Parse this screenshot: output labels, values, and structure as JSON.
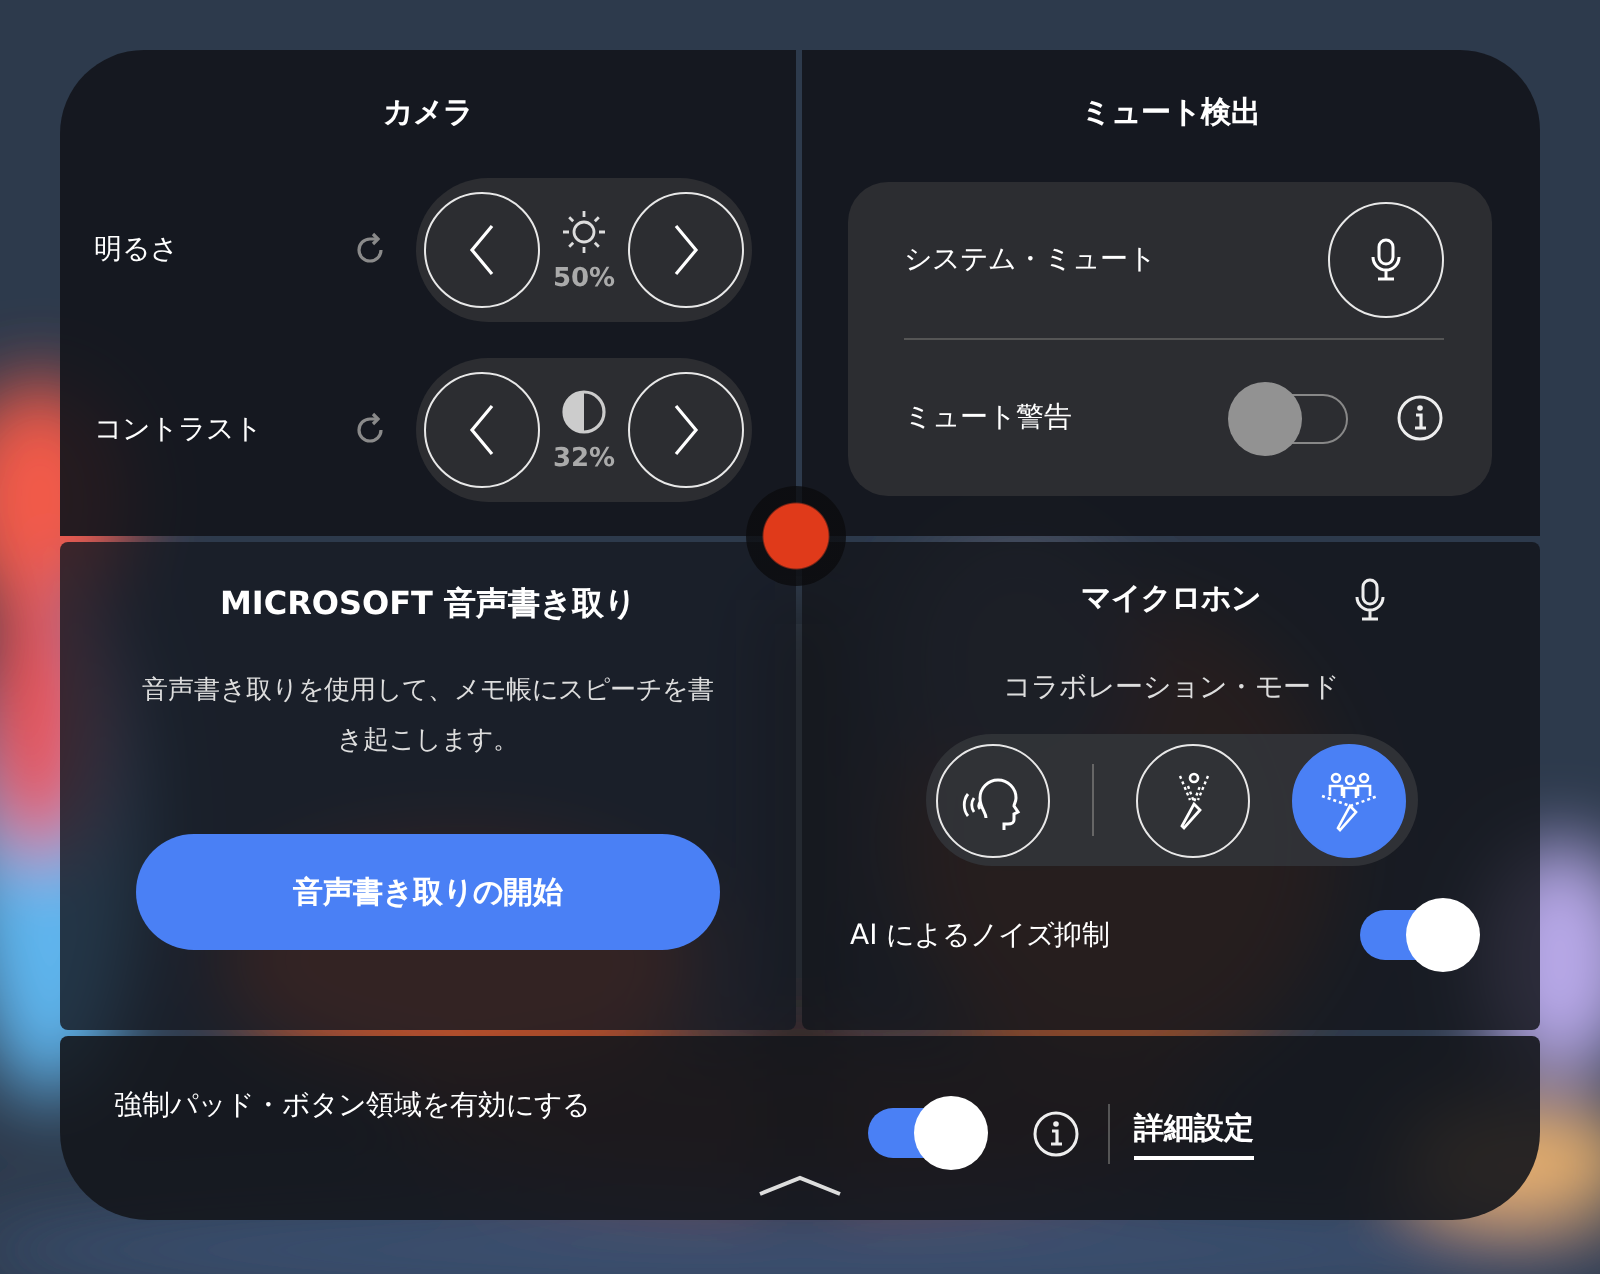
{
  "camera": {
    "title": "カメラ",
    "controls": [
      {
        "kind": "brightness",
        "label": "明るさ",
        "value": "50%"
      },
      {
        "kind": "contrast",
        "label": "コントラスト",
        "value": "32%"
      }
    ]
  },
  "mute_detection": {
    "title": "ミュート検出",
    "system_mute": {
      "label": "システム・ミュート"
    },
    "mute_warning": {
      "label": "ミュート警告",
      "on": false
    }
  },
  "dictation": {
    "title": "MICROSOFT 音声書き取り",
    "description": "音声書き取りを使用して、メモ帳にスピーチを書き起こします。",
    "button": "音声書き取りの開始"
  },
  "microphone": {
    "title": "マイクロホン",
    "mode_label": "コラボレーション・モード",
    "modes": [
      {
        "kind": "voice-focus",
        "selected": false
      },
      {
        "kind": "cardioid",
        "selected": false
      },
      {
        "kind": "collaboration",
        "selected": true
      }
    ],
    "noise_suppression": {
      "label": "AI によるノイズ抑制",
      "on": true
    }
  },
  "footer": {
    "pad_button_area": {
      "label": "強制パッド・ボタン領域を有効にする",
      "on": true
    },
    "advanced_link": "詳細設定"
  }
}
